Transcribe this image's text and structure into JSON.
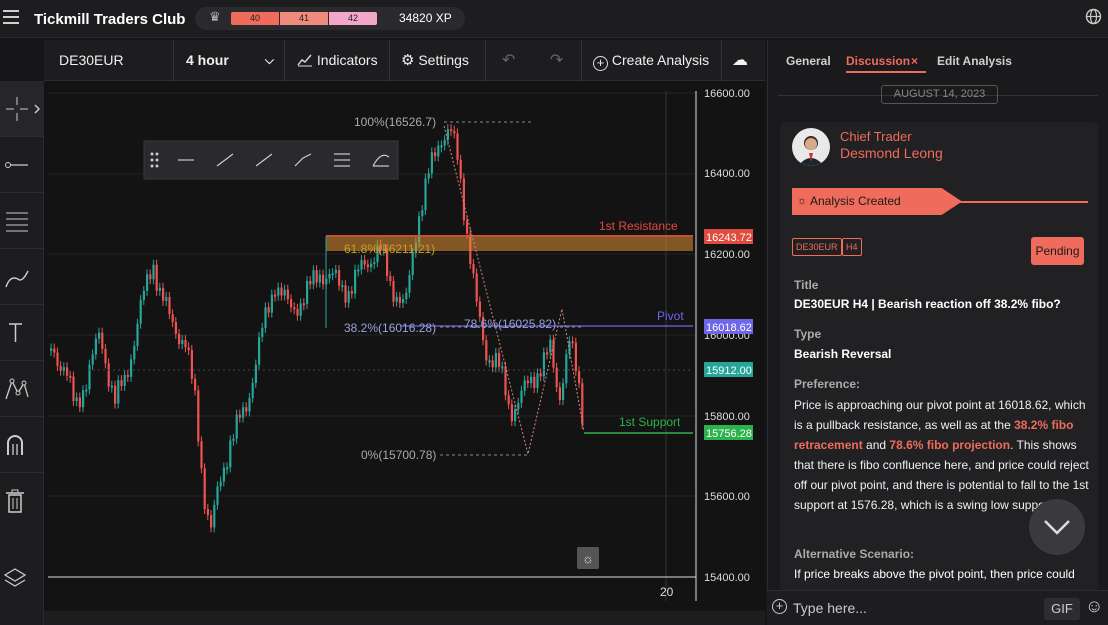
{
  "app": {
    "title": "Tickmill Traders Club",
    "levels": [
      "40",
      "41",
      "42"
    ],
    "xp": "34820 XP"
  },
  "toolbar": {
    "symbol": "DE30EUR",
    "timeframe": "4 hour",
    "indicators": "Indicators",
    "settings": "Settings",
    "create": "Create Analysis"
  },
  "chart": {
    "y_ticks": [
      "16600.00",
      "16400.00",
      "16200.00",
      "16000.00",
      "15800.00",
      "15600.00",
      "15400.00"
    ],
    "x_tick": "20",
    "levels": {
      "resistance": {
        "label": "1st Resistance",
        "value": "16243.72"
      },
      "pivot": {
        "label": "Pivot",
        "value": "16018.62"
      },
      "current": {
        "value": "15912.00"
      },
      "support": {
        "label": "1st Support",
        "value": "15756.28"
      }
    },
    "fibs": {
      "f100": "100%(16526.7)",
      "f618": "61.8%(16211.21)",
      "f382": "38.2%(16016.28)",
      "f786": "78.6%(16025.82)",
      "f0": "0%(15700.78)"
    },
    "colors": {
      "up": "#26a69a",
      "down": "#ef5350",
      "resistance": "#e04b3f",
      "pivot": "#6f66e8",
      "support": "#2bb24c"
    }
  },
  "panel": {
    "tabs": [
      "General",
      "Discussion",
      "Edit Analysis"
    ],
    "date": "AUGUST 14, 2023",
    "role": "Chief Trader",
    "author": "Desmond Leong",
    "created": "Analysis Created",
    "tags": [
      "DE30EUR",
      "H4"
    ],
    "status": "Pending",
    "title_label": "Title",
    "title": "DE30EUR H4 | Bearish reaction off 38.2% fibo?",
    "type_label": "Type",
    "type": "Bearish Reversal",
    "pref_label": "Preference:",
    "pref_1": "Price is approaching our pivot point at 16018.62, which is a pullback resistance, as well as at the ",
    "pref_h1": "38.2% fibo retracement",
    "pref_2": " and ",
    "pref_h2": "78.6% fibo projection",
    "pref_3": ". This shows that there is fibo confluence here, and price could reject off our pivot point, and there is potential to fall to the 1st support at 1576.28, which is a swing low support.",
    "alt_label": "Alternative Scenario:",
    "alt": "If price breaks above the pivot point, then price could",
    "placeholder": "Type here...",
    "gif": "GIF"
  }
}
